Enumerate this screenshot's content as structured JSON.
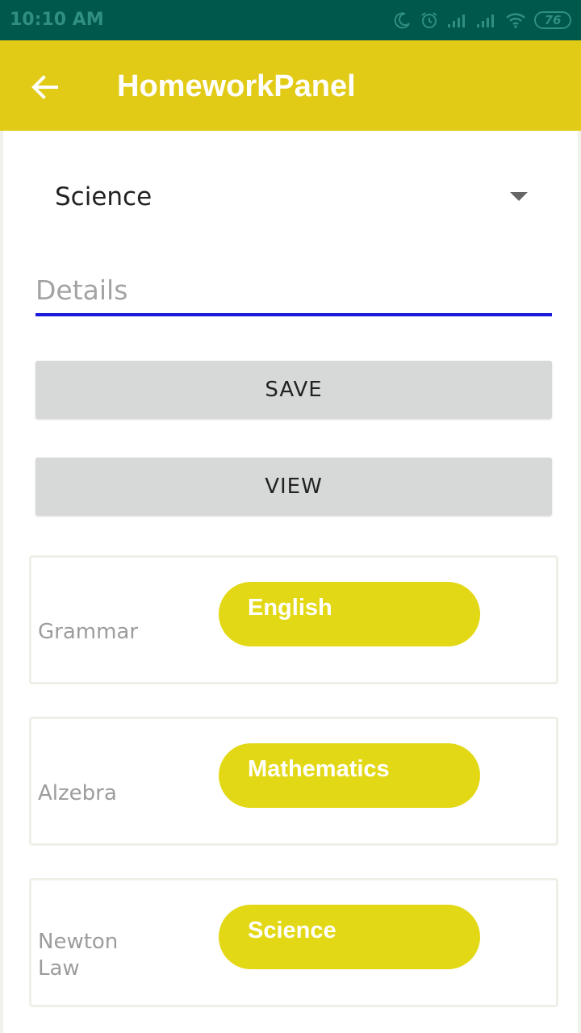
{
  "status_bar": {
    "time": "10:10 AM",
    "battery_level": "76",
    "icons": [
      "moon-icon",
      "alarm-icon",
      "signal-icon",
      "signal-icon",
      "wifi-icon",
      "battery-icon"
    ]
  },
  "app_bar": {
    "title": "HomeworkPanel",
    "back_icon": "back-arrow-icon",
    "color": "#e2cb17"
  },
  "form": {
    "subject_selected": "Science",
    "details_placeholder": "Details",
    "details_value": "",
    "save_label": "SAVE",
    "view_label": "VIEW"
  },
  "homework_list": [
    {
      "topic": "Grammar",
      "subject": "English"
    },
    {
      "topic": "Alzebra",
      "subject": "Mathematics"
    },
    {
      "topic": "Newton Law",
      "subject": "Science"
    }
  ],
  "colors": {
    "status_bar": "#00574b",
    "accent": "#e2cb17",
    "input_underline": "#1a1adb",
    "button": "#d7d8d8"
  }
}
